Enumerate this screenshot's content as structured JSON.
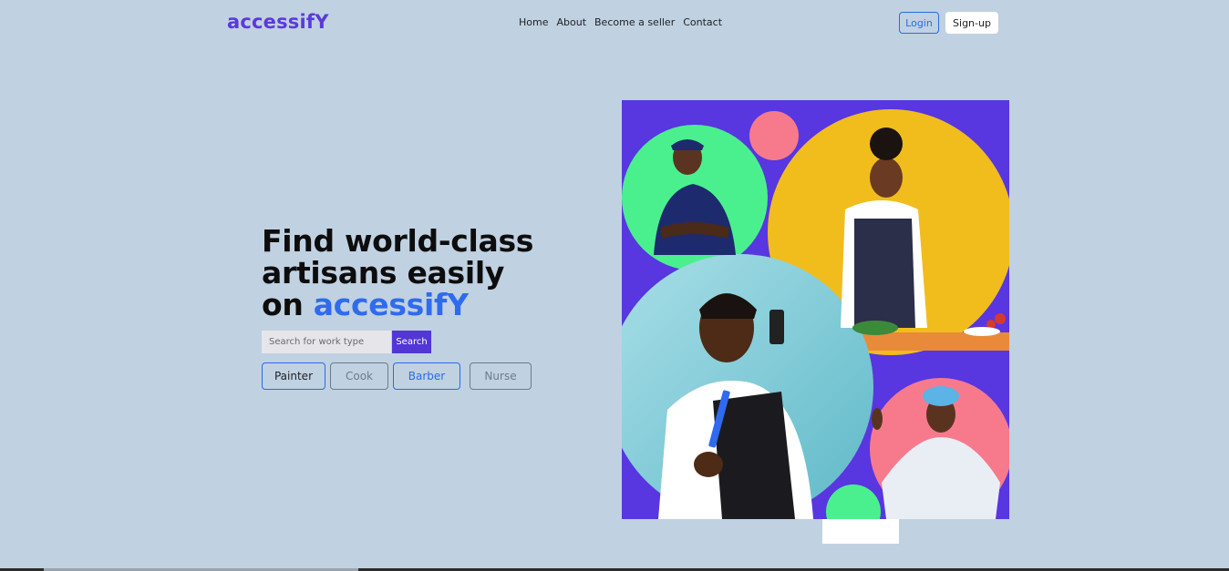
{
  "brand": {
    "logo": "accessifY",
    "color": "#5b3ad8"
  },
  "nav": {
    "links": [
      "Home",
      "About",
      "Become a seller",
      "Contact"
    ],
    "login": "Login",
    "signup": "Sign-up"
  },
  "hero": {
    "headline_line1": "Find world-class",
    "headline_line2": "artisans easily",
    "headline_prefix": "on ",
    "headline_brand": "accessifY",
    "search": {
      "placeholder": "Search for work type",
      "value": "",
      "button": "Search"
    },
    "chips": [
      "Painter",
      "Cook",
      "Barber",
      "Nurse"
    ]
  },
  "colors": {
    "background": "#c0d1e2",
    "accent_purple": "#5337d6",
    "accent_blue": "#2f6bef",
    "art_purple": "#5836e0",
    "art_green": "#4bf08e",
    "art_yellow": "#f1bd1d",
    "art_pink": "#f77a8c",
    "art_teal": "#8fd3dd"
  },
  "illustration": {
    "people": [
      "delivery-worker",
      "cook",
      "barber",
      "nurse"
    ]
  }
}
